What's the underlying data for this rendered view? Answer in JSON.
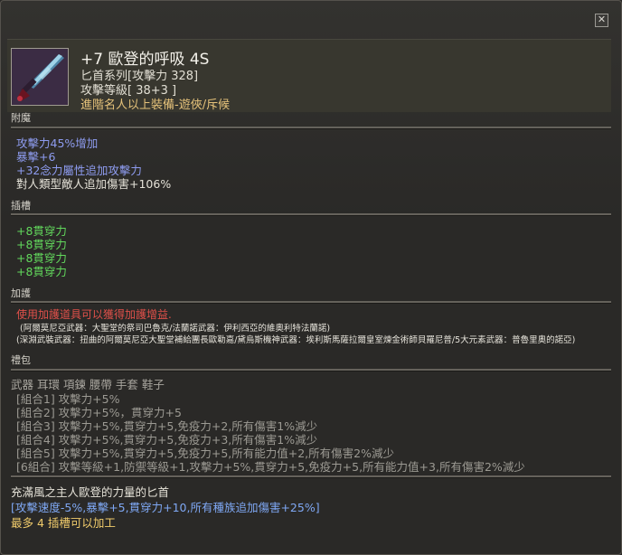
{
  "item": {
    "name": "+7 歐登的呼吸 4S",
    "type": "匕首系列[攻擊力 328]",
    "level": "攻擊等級[ 38+3 ]",
    "requirement": "進階名人以上裝備-遊俠/斥候"
  },
  "enchant": {
    "title": "附魔",
    "lines": [
      "攻擊力45%增加",
      "暴擊+6",
      "+32念力屬性追加攻擊力",
      "對人類型敵人追加傷害+106%"
    ]
  },
  "slots": {
    "title": "插槽",
    "lines": [
      "+8貫穿力",
      "+8貫穿力",
      "+8貫穿力",
      "+8貫穿力"
    ]
  },
  "protection": {
    "title": "加護",
    "warning": "使用加護道具可以獲得加護增益.",
    "note1": "(阿爾莫尼亞武器：大聖堂的祭司巴魯克/法蘭諾武器：伊利西亞的維奧利特法蘭諾)",
    "note2": "(深淵武裝武器：扭曲的阿爾莫尼亞大聖堂補給團長歐勒嘉/黛烏斯機神武器：埃利斯馬薩拉爾皇室煉金術師貝羅尼普/5大元素武器：普魯里奧的諾亞)"
  },
  "set": {
    "title": "禮包",
    "parts": "武器 耳環 項鍊 腰帶 手套 鞋子",
    "lines": [
      "[組合1] 攻擊力+5%",
      "[組合2] 攻擊力+5%，貫穿力+5",
      "[組合3] 攻擊力+5%,貫穿力+5,免疫力+2,所有傷害1%減少",
      "[組合4] 攻擊力+5%,貫穿力+5,免疫力+3,所有傷害1%減少",
      "[組合5] 攻擊力+5%,貫穿力+5,免疫力+5,所有能力值+2,所有傷害2%減少",
      "[6組合] 攻擊等級+1,防禦等級+1,攻擊力+5%,貫穿力+5,免疫力+5,所有能力值+3,所有傷害2%減少"
    ]
  },
  "footer": {
    "desc": "充滿風之主人歐登的力量的匕首",
    "bonus": "[攻擊速度-5%,暴擊+5,貫穿力+10,所有種族追加傷害+25%]",
    "slots": "最多 4 插槽可以加工"
  },
  "icons": {
    "close": "close-icon",
    "item": "dagger-icon"
  },
  "colors": {
    "enchant": "#8e9cf0",
    "slot": "#62d85c",
    "warning": "#e0504a",
    "requirement": "#e5c27a",
    "set_inactive": "#9c9a93"
  }
}
